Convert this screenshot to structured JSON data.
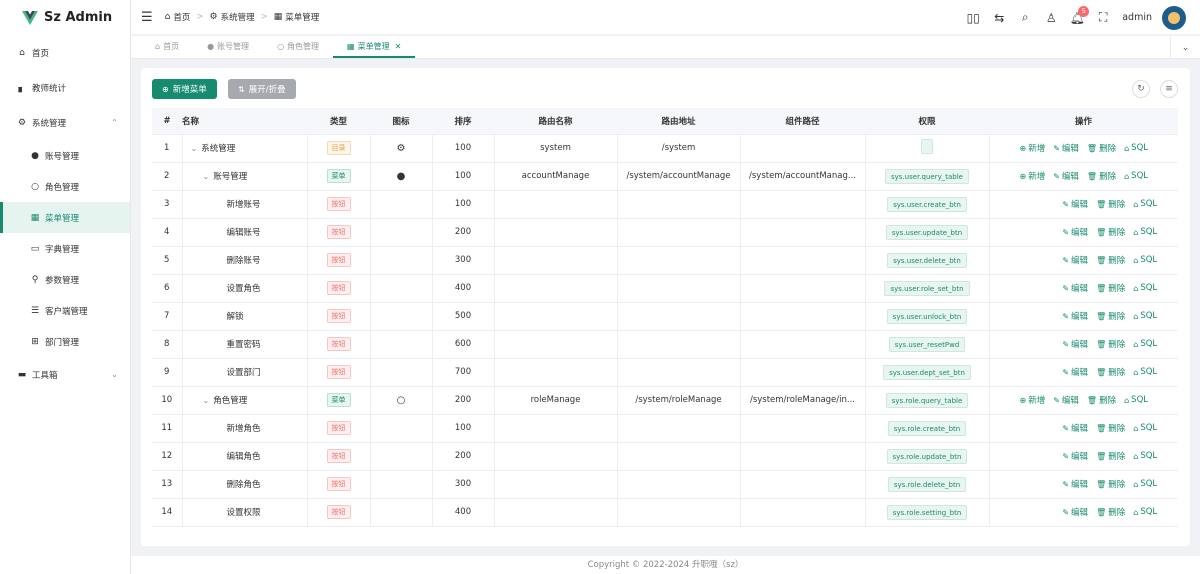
{
  "app": {
    "title": "Sz Admin"
  },
  "sidebar": {
    "items": [
      {
        "label": "首页",
        "icon": "home-icon",
        "level": "top",
        "active": false
      },
      {
        "label": "教师统计",
        "icon": "chart-icon",
        "level": "top",
        "active": false
      },
      {
        "label": "系统管理",
        "icon": "gear-icon",
        "level": "top",
        "active": false,
        "expanded": true
      },
      {
        "label": "账号管理",
        "icon": "user-icon",
        "level": "sub",
        "active": false
      },
      {
        "label": "角色管理",
        "icon": "user-outline-icon",
        "level": "sub",
        "active": false
      },
      {
        "label": "菜单管理",
        "icon": "grid-icon",
        "level": "sub",
        "active": true
      },
      {
        "label": "字典管理",
        "icon": "book-icon",
        "level": "sub",
        "active": false
      },
      {
        "label": "参数管理",
        "icon": "key-icon",
        "level": "sub",
        "active": false
      },
      {
        "label": "客户端管理",
        "icon": "list-icon",
        "level": "sub",
        "active": false
      },
      {
        "label": "部门管理",
        "icon": "org-icon",
        "level": "sub",
        "active": false
      },
      {
        "label": "工具箱",
        "icon": "toolbox-icon",
        "level": "top",
        "active": false,
        "expanded": false
      }
    ]
  },
  "header": {
    "breadcrumb": [
      "首页",
      "系统管理",
      "菜单管理"
    ],
    "username": "admin",
    "notification_count": "5"
  },
  "tabs": [
    {
      "label": "首页",
      "active": false
    },
    {
      "label": "账号管理",
      "active": false
    },
    {
      "label": "角色管理",
      "active": false
    },
    {
      "label": "菜单管理",
      "active": true
    }
  ],
  "toolbar": {
    "add_label": "新增菜单",
    "expand_label": "展开/折叠"
  },
  "table": {
    "headers": [
      "#",
      "名称",
      "类型",
      "图标",
      "排序",
      "路由名称",
      "路由地址",
      "组件路径",
      "权限",
      "操作"
    ],
    "op_labels": {
      "add": "新增",
      "edit": "编辑",
      "delete": "删除",
      "sql": "SQL"
    },
    "rows": [
      {
        "index": "1",
        "name": "系统管理",
        "indent": 0,
        "caret": true,
        "type": "目录",
        "type_kind": "dir",
        "icon": "gear-icon",
        "sort": "100",
        "route_name": "system",
        "route_path": "/system",
        "component": "",
        "permission": "",
        "perm_empty": true,
        "ops": [
          "add",
          "edit",
          "delete",
          "sql"
        ]
      },
      {
        "index": "2",
        "name": "账号管理",
        "indent": 1,
        "caret": true,
        "type": "菜单",
        "type_kind": "menu",
        "icon": "user-icon",
        "sort": "100",
        "route_name": "accountManage",
        "route_path": "/system/accountManage",
        "component": "/system/accountManag...",
        "permission": "sys.user.query_table",
        "ops": [
          "add",
          "edit",
          "delete",
          "sql"
        ]
      },
      {
        "index": "3",
        "name": "新增账号",
        "indent": 2,
        "caret": false,
        "type": "按钮",
        "type_kind": "btn",
        "icon": "",
        "sort": "100",
        "route_name": "",
        "route_path": "",
        "component": "",
        "permission": "sys.user.create_btn",
        "ops": [
          "edit",
          "delete",
          "sql"
        ]
      },
      {
        "index": "4",
        "name": "编辑账号",
        "indent": 2,
        "caret": false,
        "type": "按钮",
        "type_kind": "btn",
        "icon": "",
        "sort": "200",
        "route_name": "",
        "route_path": "",
        "component": "",
        "permission": "sys.user.update_btn",
        "ops": [
          "edit",
          "delete",
          "sql"
        ]
      },
      {
        "index": "5",
        "name": "删除账号",
        "indent": 2,
        "caret": false,
        "type": "按钮",
        "type_kind": "btn",
        "icon": "",
        "sort": "300",
        "route_name": "",
        "route_path": "",
        "component": "",
        "permission": "sys.user.delete_btn",
        "ops": [
          "edit",
          "delete",
          "sql"
        ]
      },
      {
        "index": "6",
        "name": "设置角色",
        "indent": 2,
        "caret": false,
        "type": "按钮",
        "type_kind": "btn",
        "icon": "",
        "sort": "400",
        "route_name": "",
        "route_path": "",
        "component": "",
        "permission": "sys.user.role_set_btn",
        "ops": [
          "edit",
          "delete",
          "sql"
        ]
      },
      {
        "index": "7",
        "name": "解锁",
        "indent": 2,
        "caret": false,
        "type": "按钮",
        "type_kind": "btn",
        "icon": "",
        "sort": "500",
        "route_name": "",
        "route_path": "",
        "component": "",
        "permission": "sys.user.unlock_btn",
        "ops": [
          "edit",
          "delete",
          "sql"
        ]
      },
      {
        "index": "8",
        "name": "重置密码",
        "indent": 2,
        "caret": false,
        "type": "按钮",
        "type_kind": "btn",
        "icon": "",
        "sort": "600",
        "route_name": "",
        "route_path": "",
        "component": "",
        "permission": "sys.user_resetPwd",
        "ops": [
          "edit",
          "delete",
          "sql"
        ]
      },
      {
        "index": "9",
        "name": "设置部门",
        "indent": 2,
        "caret": false,
        "type": "按钮",
        "type_kind": "btn",
        "icon": "",
        "sort": "700",
        "route_name": "",
        "route_path": "",
        "component": "",
        "permission": "sys.user.dept_set_btn",
        "ops": [
          "edit",
          "delete",
          "sql"
        ]
      },
      {
        "index": "10",
        "name": "角色管理",
        "indent": 1,
        "caret": true,
        "type": "菜单",
        "type_kind": "menu",
        "icon": "user-outline-icon",
        "sort": "200",
        "route_name": "roleManage",
        "route_path": "/system/roleManage",
        "component": "/system/roleManage/in...",
        "permission": "sys.role.query_table",
        "ops": [
          "add",
          "edit",
          "delete",
          "sql"
        ]
      },
      {
        "index": "11",
        "name": "新增角色",
        "indent": 2,
        "caret": false,
        "type": "按钮",
        "type_kind": "btn",
        "icon": "",
        "sort": "100",
        "route_name": "",
        "route_path": "",
        "component": "",
        "permission": "sys.role.create_btn",
        "ops": [
          "edit",
          "delete",
          "sql"
        ]
      },
      {
        "index": "12",
        "name": "编辑角色",
        "indent": 2,
        "caret": false,
        "type": "按钮",
        "type_kind": "btn",
        "icon": "",
        "sort": "200",
        "route_name": "",
        "route_path": "",
        "component": "",
        "permission": "sys.role.update_btn",
        "ops": [
          "edit",
          "delete",
          "sql"
        ]
      },
      {
        "index": "13",
        "name": "删除角色",
        "indent": 2,
        "caret": false,
        "type": "按钮",
        "type_kind": "btn",
        "icon": "",
        "sort": "300",
        "route_name": "",
        "route_path": "",
        "component": "",
        "permission": "sys.role.delete_btn",
        "ops": [
          "edit",
          "delete",
          "sql"
        ]
      },
      {
        "index": "14",
        "name": "设置权限",
        "indent": 2,
        "caret": false,
        "type": "按钮",
        "type_kind": "btn",
        "icon": "",
        "sort": "400",
        "route_name": "",
        "route_path": "",
        "component": "",
        "permission": "sys.role.setting_btn",
        "ops": [
          "edit",
          "delete",
          "sql"
        ]
      }
    ]
  },
  "footer": {
    "text": "Copyright © 2022-2024 升职哦（sz）"
  },
  "colors": {
    "primary": "#168b6f",
    "danger": "#f56c6c",
    "warning": "#e6a23c"
  }
}
